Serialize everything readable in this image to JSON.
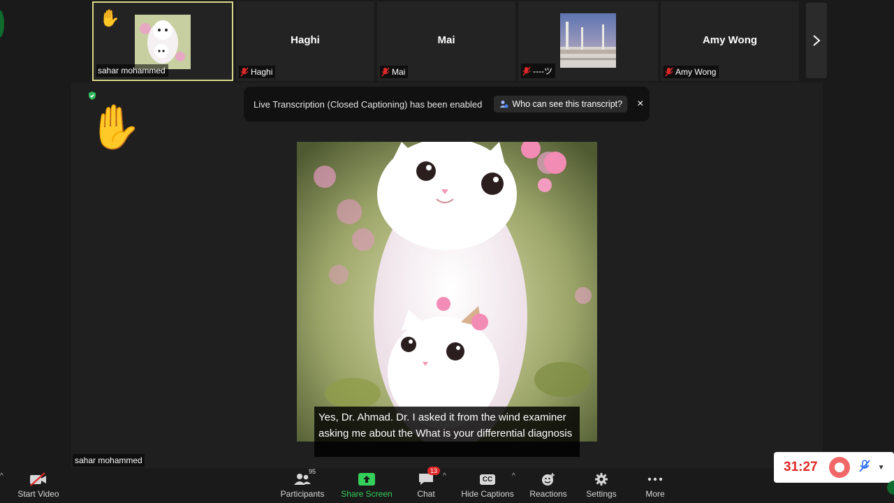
{
  "gallery": {
    "tiles": [
      {
        "name": "sahar mohammed",
        "label": "sahar mohammed",
        "has_image": true,
        "raised_hand": true,
        "muted": false
      },
      {
        "name": "Haghi",
        "label": "Haghi",
        "has_image": false,
        "muted": true
      },
      {
        "name": "Mai",
        "label": "Mai",
        "has_image": false,
        "muted": true
      },
      {
        "name": "----ツ",
        "label": "----ツ",
        "has_image": true,
        "muted": true
      },
      {
        "name": "Amy Wong",
        "label": "Amy Wong",
        "has_image": false,
        "muted": true
      }
    ],
    "next_icon": "chevron-right-icon"
  },
  "banner": {
    "message": "Live Transcription (Closed Captioning) has been enabled",
    "who_label": "Who can see this transcript?",
    "close_glyph": "×"
  },
  "main": {
    "speaker_name": "sahar mohammed",
    "raised_hand_glyph": "✋"
  },
  "caption": {
    "text": "Yes, Dr. Ahmad. Dr. I asked it from the wind examiner asking me about the What is your differential diagnosis"
  },
  "toolbar": {
    "start_video": "Start Video",
    "participants": "Participants",
    "participants_count": "95",
    "share_screen": "Share Screen",
    "chat": "Chat",
    "chat_badge": "13",
    "hide_captions": "Hide Captions",
    "cc_glyph": "CC",
    "reactions": "Reactions",
    "settings": "Settings",
    "more": "More"
  },
  "recording": {
    "timer": "31:27"
  },
  "colors": {
    "background": "#1a1a1a",
    "share_green": "#35d05a",
    "record_red": "#e02828",
    "active_tile_border": "#d9d98a"
  }
}
